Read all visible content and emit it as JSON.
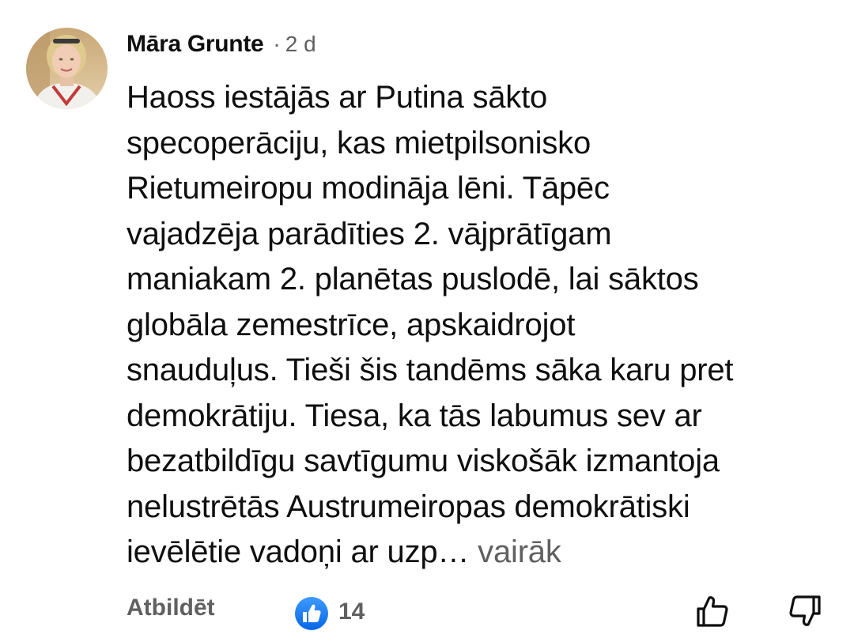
{
  "comment": {
    "author": "Māra Grunte",
    "separator": "·",
    "time": "2 d",
    "lines": [
      "Haoss iestājās ar Putina sākto",
      "specoperāciju, kas mietpilsonisko",
      "Rietumeiropu modināja lēni. Tāpēc",
      "vajadzēja parādīties 2. vājprātīgam",
      "maniakam 2. planētas puslodē, lai sāktos",
      "globāla zemestrīce, apskaidrojot",
      "snauduļus. Tieši šis tandēms sāka karu pret",
      "demokrātiju. Tiesa, ka tās labumus sev ar",
      "bezatbildīgu savtīgumu viskošāk izmantoja",
      "nelustrētās Austrumeiropas demokrātiski",
      "ievēlētie vadoņi ar uzp…"
    ],
    "more_label": "vairāk"
  },
  "actions": {
    "reply_label": "Atbildēt",
    "like_count": "14",
    "like_badge_icon": "thumbs-up-badge-icon",
    "like_icon": "thumbs-up-icon",
    "dislike_icon": "thumbs-down-icon"
  },
  "colors": {
    "text_primary": "#0f0f0f",
    "text_secondary": "#606060",
    "like_badge_blue": "#1877f2"
  }
}
